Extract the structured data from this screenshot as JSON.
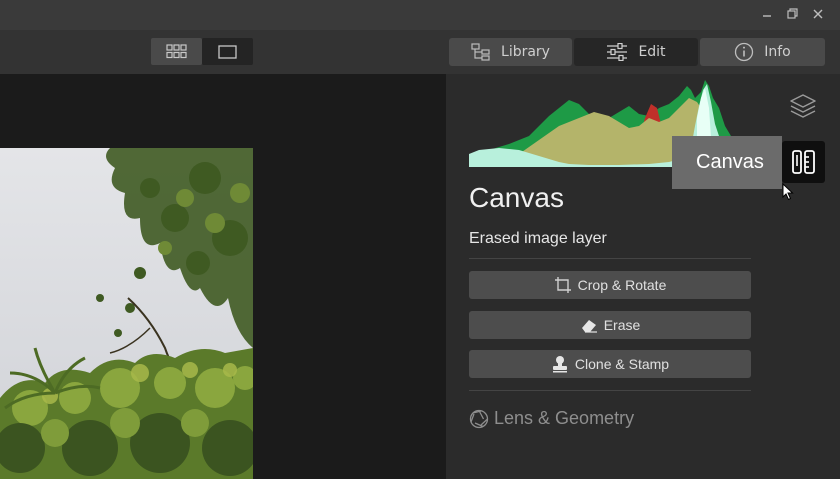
{
  "window": {
    "minimize_icon": "minimize-icon",
    "restore_icon": "restore-icon",
    "close_icon": "close-icon"
  },
  "toolbar": {
    "view_toggles": [
      {
        "icon": "grid-view-icon",
        "active": false
      },
      {
        "icon": "single-view-icon",
        "active": true
      }
    ],
    "tabs": [
      {
        "label": "Library",
        "icon": "library-icon",
        "active": false
      },
      {
        "label": "Edit",
        "icon": "sliders-icon",
        "active": true
      },
      {
        "label": "Info",
        "icon": "info-icon",
        "active": false
      }
    ]
  },
  "panel": {
    "tooltip": "Canvas",
    "title": "Canvas",
    "layer_name": "Erased image layer",
    "tools": [
      {
        "label": "Crop & Rotate",
        "icon": "crop-icon"
      },
      {
        "label": "Erase",
        "icon": "eraser-icon"
      },
      {
        "label": "Clone & Stamp",
        "icon": "stamp-icon"
      }
    ],
    "lens_label": "Lens & Geometry",
    "lens_icon": "aperture-icon",
    "layers_icon": "layers-icon",
    "canvas_icon": "canvas-icon"
  },
  "colors": {
    "accent_active": "#262626",
    "histogram_green": "#1e9a46",
    "histogram_olive": "#b4b46a",
    "histogram_red": "#c0302a",
    "histogram_cyan": "#b8f0dc"
  }
}
